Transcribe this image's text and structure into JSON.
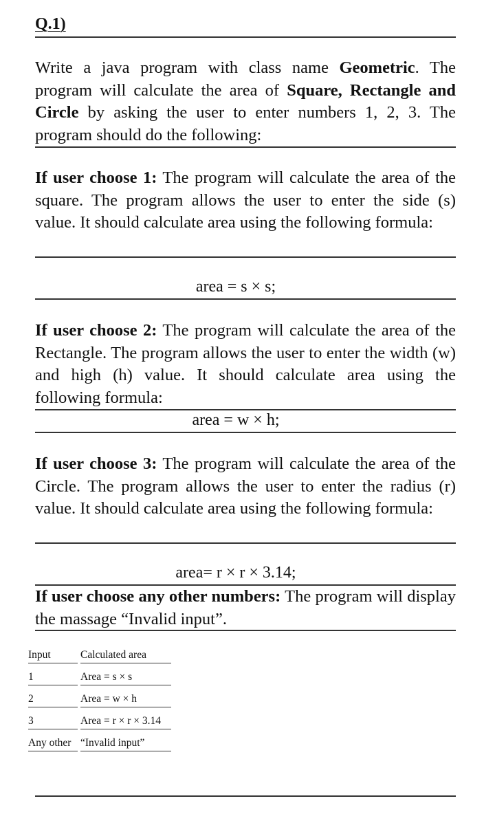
{
  "question": {
    "label": "Q.1)"
  },
  "intro": {
    "text_1": "Write a java program with class name ",
    "class_name": "Geometric",
    "text_2": ". The program will calculate the area of ",
    "shapes": "Square, Rectangle and Circle",
    "text_3": " by asking the user to enter numbers 1, 2, 3. The program should do the following:"
  },
  "cases": [
    {
      "heading": "If user choose 1:",
      "body": " The program will calculate the area of the square. The program allows the user to enter the side (s) value.  It should calculate area using the following formula:",
      "formula": "area = s × s;"
    },
    {
      "heading": "If user choose 2:",
      "body": " The program will calculate the area of the Rectangle. The program allows the user to enter the width (w) and high (h) value.  It should calculate area using the following formula:",
      "formula": "area = w × h;"
    },
    {
      "heading": "If user choose 3:",
      "body": " The program will calculate the area of the Circle. The program allows the user to enter the radius (r) value.  It should calculate area using the following formula:",
      "formula": "area= r × r × 3.14;"
    },
    {
      "heading": "If user choose any other numbers:",
      "body": " The program will display the massage “Invalid input”."
    }
  ],
  "table": {
    "headers": [
      "Input",
      "Calculated area"
    ],
    "rows": [
      [
        "1",
        "Area = s × s"
      ],
      [
        "2",
        "Area = w × h"
      ],
      [
        "3",
        "Area = r × r × 3.14"
      ],
      [
        "Any other",
        "“Invalid input”"
      ]
    ]
  }
}
